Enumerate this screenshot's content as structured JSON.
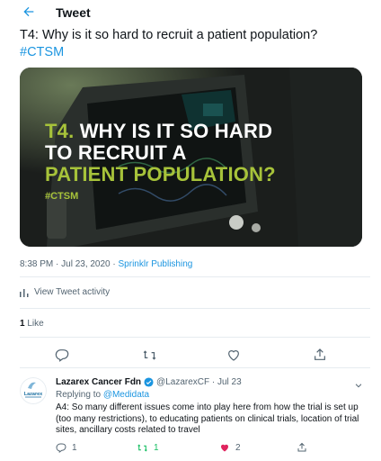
{
  "header": {
    "title": "Tweet",
    "back_icon": "arrow-left-icon"
  },
  "tweet": {
    "text": "T4: Why is it so hard to recruit a patient population?",
    "hashtag": "#CTSM",
    "media": {
      "prefix": "T4.",
      "line1_rest": " WHY IS IT SO HARD",
      "line2": "TO RECRUIT A",
      "line3_accent": "PATIENT POPULATION?",
      "tag": "#CTSM",
      "accent_color": "#a7c33a"
    },
    "timestamp": "8:38 PM · Jul 23, 2020",
    "separator": " · ",
    "source": "Sprinklr Publishing",
    "activity_label": "View Tweet activity",
    "likes_count": "1",
    "likes_label": " Like"
  },
  "actions": {
    "reply_icon": "reply-icon",
    "retweet_icon": "retweet-icon",
    "like_icon": "heart-icon",
    "share_icon": "share-icon"
  },
  "reply": {
    "name": "Lazarex Cancer Fdn",
    "handle": "@LazarexCF · Jul 23",
    "replying_prefix": "Replying to ",
    "replying_mention": "@Medidata",
    "body": "A4: So many different issues come into play here from how the trial is set up (too many restrictions), to educating patients on clinical trials, location of trial sites, ancillary costs related to travel",
    "avatar_text": "Lazarex",
    "reply_count": "1",
    "retweet_count": "1",
    "like_count": "2"
  },
  "colors": {
    "link": "#1b95e0",
    "retweet_green": "#17bf63",
    "like_red": "#e0245e"
  }
}
